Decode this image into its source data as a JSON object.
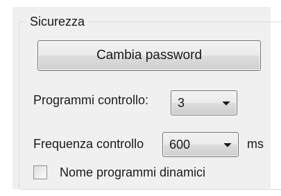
{
  "security": {
    "group_title": "Sicurezza",
    "change_password_label": "Cambia password",
    "control_programs": {
      "label": "Programmi controllo:",
      "selected": "3"
    },
    "control_frequency": {
      "label": "Frequenza controllo",
      "selected": "600",
      "unit": "ms"
    },
    "dynamic_program_names": {
      "label": "Nome programmi dinamici",
      "checked": false
    }
  },
  "icons": {
    "dropdown": "chevron-down-icon",
    "checkbox": "checkbox-unchecked-icon"
  }
}
